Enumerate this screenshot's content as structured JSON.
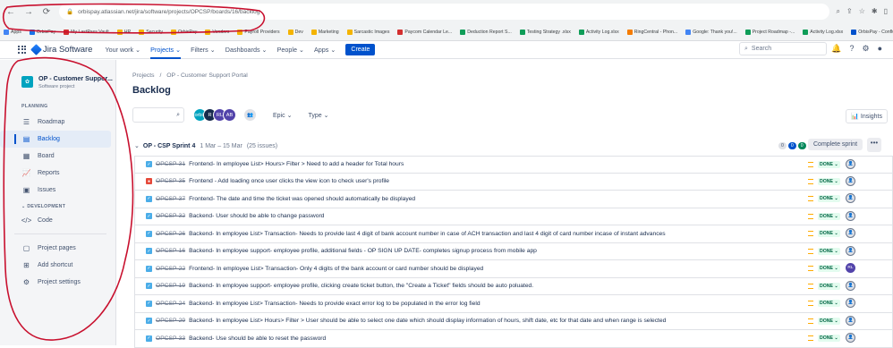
{
  "browser": {
    "url": "orbispay.atlassian.net/jira/software/projects/OPCSP/boards/16/backlog",
    "bookmarks": [
      {
        "label": "Apps",
        "color": "#4285f4"
      },
      {
        "label": "OrbisPay",
        "color": "#1a73e8"
      },
      {
        "label": "My LastPass Vault",
        "color": "#d32f2f"
      },
      {
        "label": "HR",
        "color": "#f4b400"
      },
      {
        "label": "Security",
        "color": "#f4b400"
      },
      {
        "label": "OrbisPay",
        "color": "#f4b400"
      },
      {
        "label": "Vendors",
        "color": "#f4b400"
      },
      {
        "label": "Payroll Providers",
        "color": "#f4b400"
      },
      {
        "label": "Dev",
        "color": "#f4b400"
      },
      {
        "label": "Marketing",
        "color": "#f4b400"
      },
      {
        "label": "Sarcastic Images",
        "color": "#f4b400"
      },
      {
        "label": "Paycom Calendar Le...",
        "color": "#d32f2f"
      },
      {
        "label": "Deduction Report S...",
        "color": "#0f9d58"
      },
      {
        "label": "Testing Strategy .xlsx",
        "color": "#0f9d58"
      },
      {
        "label": "Activity Log.xlsx",
        "color": "#0f9d58"
      },
      {
        "label": "RingCentral - Phon...",
        "color": "#f57c00"
      },
      {
        "label": "Google: Thank you!...",
        "color": "#4285f4"
      },
      {
        "label": "Project Roadmap -...",
        "color": "#0f9d58"
      },
      {
        "label": "Activity Log.xlsx",
        "color": "#0f9d58"
      },
      {
        "label": "OrbisPay - Conflue...",
        "color": "#0052cc"
      }
    ],
    "reading_list": "Reading"
  },
  "topnav": {
    "product": "Jira Software",
    "items": [
      "Your work",
      "Projects",
      "Filters",
      "Dashboards",
      "People",
      "Apps"
    ],
    "create": "Create",
    "search_placeholder": "Search"
  },
  "sidebar": {
    "project_name": "OP - Customer Suppor...",
    "project_type": "Software project",
    "planning_header": "PLANNING",
    "planning_items": [
      "Roadmap",
      "Backlog",
      "Board",
      "Reports",
      "Issues"
    ],
    "development_header": "DEVELOPMENT",
    "dev_items": [
      "Code"
    ],
    "bottom_items": [
      "Project pages",
      "Add shortcut",
      "Project settings"
    ]
  },
  "main": {
    "breadcrumb_projects": "Projects",
    "breadcrumb_sep": "/",
    "breadcrumb_project": "OP - Customer Support Portal",
    "title": "Backlog",
    "avatars": [
      {
        "initials": "orbis",
        "color": "#00a3bf"
      },
      {
        "initials": "R",
        "color": "#172b4d"
      },
      {
        "initials": "RL",
        "color": "#5243aa"
      },
      {
        "initials": "AB",
        "color": "#5243aa"
      }
    ],
    "epic_filter": "Epic",
    "type_filter": "Type",
    "insights": "Insights",
    "sprint": {
      "name": "OP - CSP Sprint 4",
      "dates": "1 Mar – 15 Mar",
      "count": "(25 issues)",
      "pills": [
        "0",
        "0",
        "0"
      ],
      "complete": "Complete sprint"
    },
    "issues": [
      {
        "type": "task",
        "key": "OPCSP-31",
        "summary": "Frontend- In employee List> Hours> Filter > Need to add a header for Total hours",
        "status": "DONE",
        "assignee": ""
      },
      {
        "type": "bug",
        "key": "OPCSP-35",
        "summary": "Frontend - Add loading once user clicks the view icon to check user's profile",
        "status": "DONE",
        "assignee": ""
      },
      {
        "type": "task",
        "key": "OPCSP-37",
        "summary": "Frontend- The date and time the ticket was opened should automatically be displayed",
        "status": "DONE",
        "assignee": ""
      },
      {
        "type": "task",
        "key": "OPCSP-32",
        "summary": "Backend- User should be able to change password",
        "status": "DONE",
        "assignee": ""
      },
      {
        "type": "task",
        "key": "OPCSP-26",
        "summary": "Backend- In employee List> Transaction- Needs to provide last 4 digit of bank account number in case of ACH transaction and last 4 digit of card number incase of instant advances",
        "status": "DONE",
        "assignee": ""
      },
      {
        "type": "task",
        "key": "OPCSP-16",
        "summary": "Backend- In employee support- employee profile, additional fields - OP SIGN UP DATE- completes signup process from mobile app",
        "status": "DONE",
        "assignee": ""
      },
      {
        "type": "task",
        "key": "OPCSP-22",
        "summary": "Frontend- In employee List> Transaction- Only 4 digits of the bank account or card number should be displayed",
        "status": "DONE",
        "assignee": "RL"
      },
      {
        "type": "task",
        "key": "OPCSP-19",
        "summary": "Backend- In employee support- employee profile, clicking create ticket button, the \"Create a Ticket\" fields should be auto poluated.",
        "status": "DONE",
        "assignee": ""
      },
      {
        "type": "task",
        "key": "OPCSP-24",
        "summary": "Backend- In employee List> Transaction- Needs to provide exact error log to be populated in the error log field",
        "status": "DONE",
        "assignee": ""
      },
      {
        "type": "task",
        "key": "OPCSP-29",
        "summary": "Backend- In employee List> Hours> Filter > User should be able to select one date which should display information of hours, shift date, etc for that date and when range is selected",
        "status": "DONE",
        "assignee": ""
      },
      {
        "type": "task",
        "key": "OPCSP-33",
        "summary": "Backend- Use should be able to reset the password",
        "status": "DONE",
        "assignee": ""
      }
    ]
  },
  "colors": {
    "accent": "#0052cc",
    "annotation": "#c8102e",
    "done_bg": "#e3fcef",
    "done_text": "#006644"
  }
}
